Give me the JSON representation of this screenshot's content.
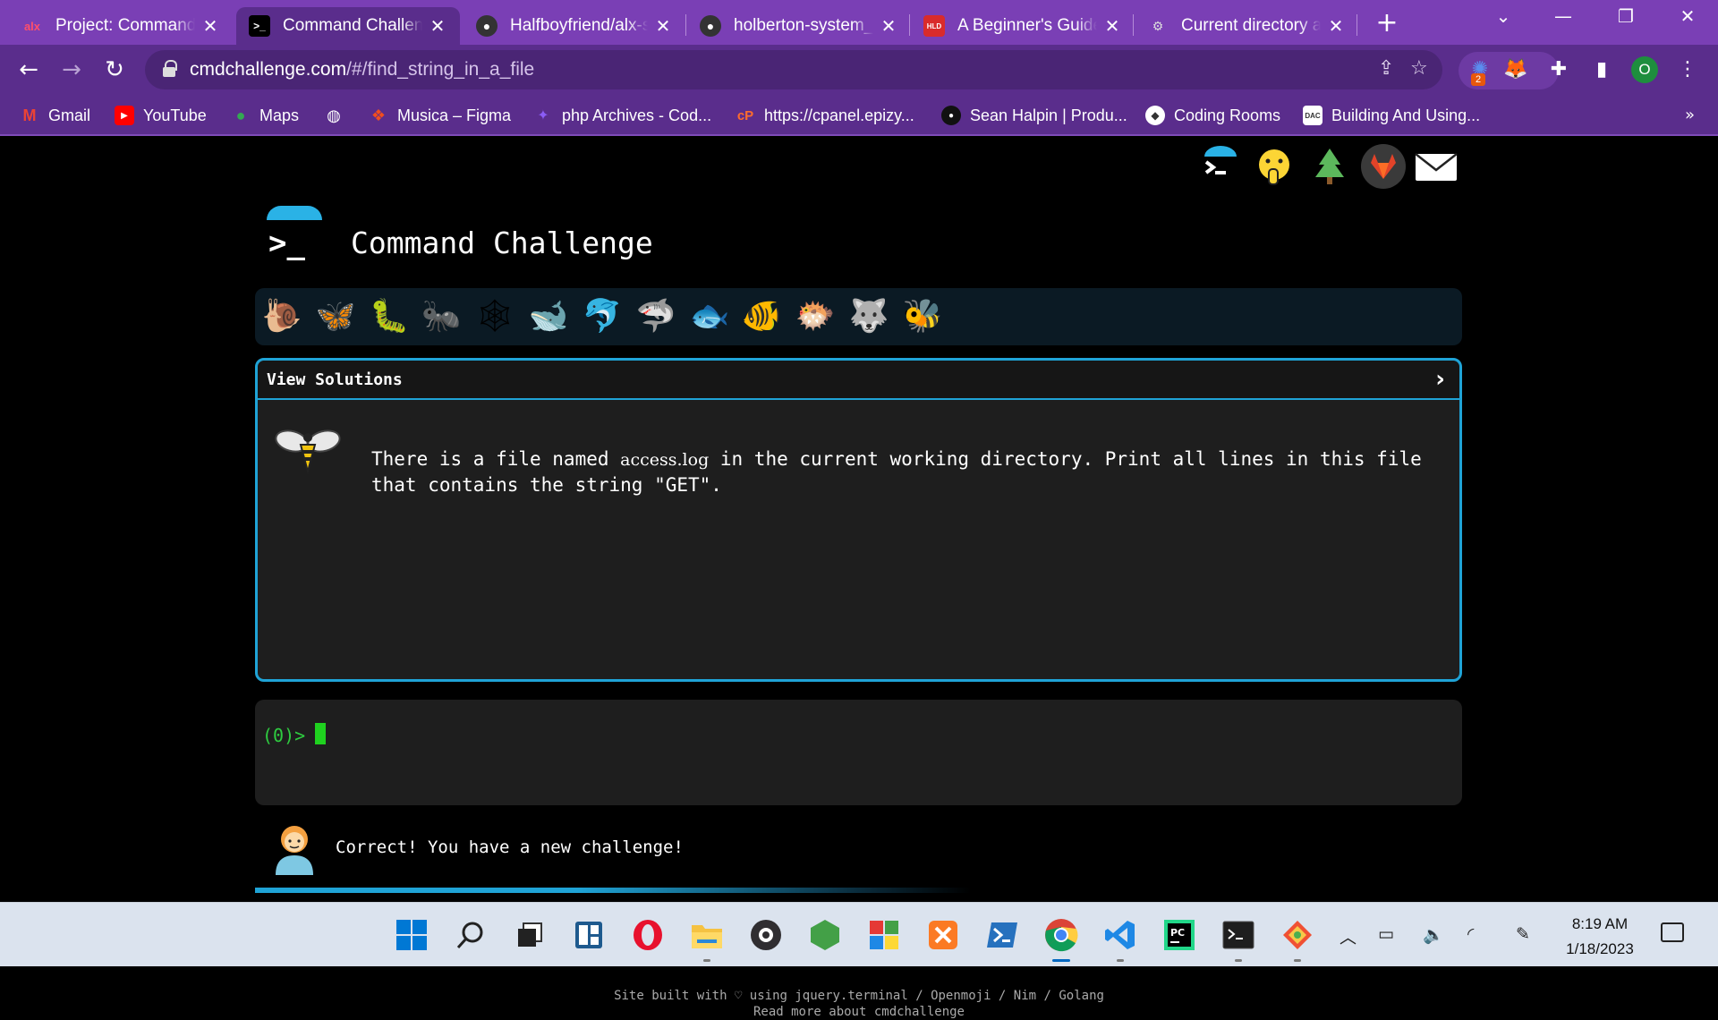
{
  "browser": {
    "tabs": [
      {
        "title": "Project: Command",
        "favicon": "alx",
        "active": false
      },
      {
        "title": "Command Challenge",
        "favicon": ">_",
        "active": true
      },
      {
        "title": "Halfboyfriend/alx-s",
        "favicon": "github",
        "active": false
      },
      {
        "title": "holberton-system_e",
        "favicon": "github",
        "active": false
      },
      {
        "title": "A Beginner's Guide",
        "favicon": "HLD",
        "active": false
      },
      {
        "title": "Current directory ar",
        "favicon": "odoo",
        "active": false
      }
    ],
    "url_domain": "cmdchallenge.com",
    "url_path": "/#/find_string_in_a_file",
    "profile_initial": "O",
    "extension_badge": "2",
    "bookmarks": [
      {
        "label": "Gmail",
        "icon": "gmail-icon",
        "color": "#ea4335"
      },
      {
        "label": "YouTube",
        "icon": "youtube-icon",
        "color": "#ff0000"
      },
      {
        "label": "Maps",
        "icon": "maps-icon",
        "color": "#34a853"
      },
      {
        "label": "",
        "icon": "globe-icon",
        "color": "#ffffff"
      },
      {
        "label": "Musica – Figma",
        "icon": "figma-icon",
        "color": "#f24e1e"
      },
      {
        "label": "php Archives - Cod...",
        "icon": "codeburst-icon",
        "color": "#8b5cf6"
      },
      {
        "label": "https://cpanel.epizy...",
        "icon": "cpanel-icon",
        "color": "#ff6c2c"
      },
      {
        "label": "Sean Halpin | Produ...",
        "icon": "dot-icon",
        "color": "#111111"
      },
      {
        "label": "Coding Rooms",
        "icon": "codingrooms-icon",
        "color": "#ffffff"
      },
      {
        "label": "Building And Using...",
        "icon": "dac-icon",
        "color": "#ffffff"
      }
    ]
  },
  "page": {
    "title": "Command Challenge",
    "view_solutions_label": "View Solutions",
    "challenge": {
      "before": "There is a file named ",
      "filename": "access.log",
      "after": " in the current working directory. Print all lines in this file that contains the string \"GET\"."
    },
    "terminal_prompt": "(0)>",
    "status_message": "Correct! You have a new challenge!",
    "footer_line1": "Site built with ♡ using jquery.terminal / Openmoji / Nim / Golang",
    "footer_line2": "Read more about cmdchallenge",
    "achievements": [
      "snail",
      "butterfly",
      "caterpillar",
      "ant",
      "spider-web",
      "whale",
      "dolphin",
      "shark",
      "fish",
      "tropical-fish",
      "blowfish",
      "wolf",
      "bee"
    ]
  },
  "taskbar": {
    "apps": [
      "start",
      "search",
      "task-view",
      "widgets",
      "opera",
      "file-explorer",
      "obs",
      "node",
      "office",
      "xampp",
      "powershell",
      "chrome",
      "vscode",
      "pycharm",
      "terminal",
      "git"
    ],
    "time": "8:19 AM",
    "date": "1/18/2023"
  },
  "colors": {
    "accent": "#1fa3d6",
    "browser_purple": "#7a3fb5",
    "prompt_green": "#2ecc40"
  }
}
